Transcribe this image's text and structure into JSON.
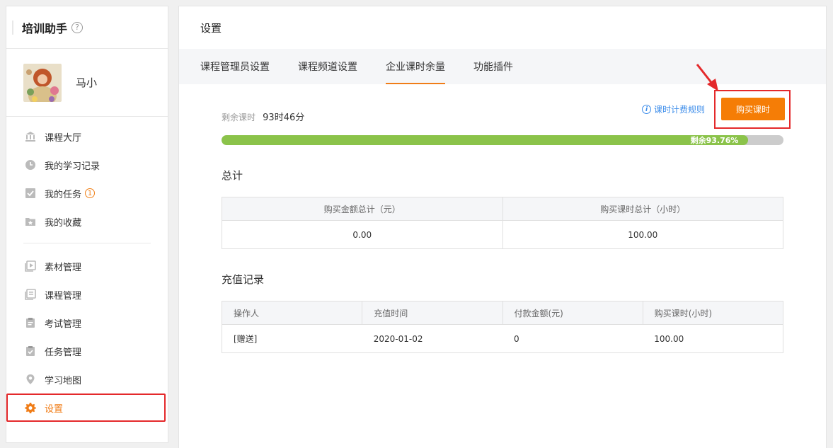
{
  "sidebar": {
    "title": "培训助手",
    "help_icon": "?",
    "user": {
      "name": "马小"
    },
    "items": [
      {
        "label": "课程大厅",
        "icon": "bank-icon"
      },
      {
        "label": "我的学习记录",
        "icon": "clock-icon"
      },
      {
        "label": "我的任务",
        "icon": "check-square-icon",
        "badge": "1"
      },
      {
        "label": "我的收藏",
        "icon": "star-folder-icon"
      },
      {
        "label": "素材管理",
        "icon": "media-icon"
      },
      {
        "label": "课程管理",
        "icon": "course-icon"
      },
      {
        "label": "考试管理",
        "icon": "exam-icon"
      },
      {
        "label": "任务管理",
        "icon": "task-icon"
      },
      {
        "label": "学习地图",
        "icon": "map-pin-icon"
      },
      {
        "label": "设置",
        "icon": "gear-icon",
        "active": true
      }
    ]
  },
  "main": {
    "title": "设置",
    "tabs": [
      {
        "label": "课程管理员设置"
      },
      {
        "label": "课程频道设置"
      },
      {
        "label": "企业课时余量",
        "active": true
      },
      {
        "label": "功能插件"
      }
    ],
    "remaining": {
      "label": "剩余课时",
      "value": "93时46分"
    },
    "rule_link": "课时计费规则",
    "buy_button": "购买课时",
    "progress": {
      "percent": 93.76,
      "label": "剩余93.76%"
    },
    "summary": {
      "title": "总计",
      "headers": [
        "购买金额总计（元）",
        "购买课时总计（小时）"
      ],
      "rows": [
        [
          "0.00",
          "100.00"
        ]
      ]
    },
    "records": {
      "title": "充值记录",
      "headers": [
        "操作人",
        "充值时间",
        "付款金额(元)",
        "购买课时(小时)"
      ],
      "rows": [
        [
          "[赠送]",
          "2020-01-02",
          "0",
          "100.00"
        ]
      ]
    }
  },
  "colors": {
    "accent": "#f07d18",
    "highlight_box": "#e4292b",
    "progress_fill": "#8bc34a",
    "link": "#3b8cea"
  }
}
